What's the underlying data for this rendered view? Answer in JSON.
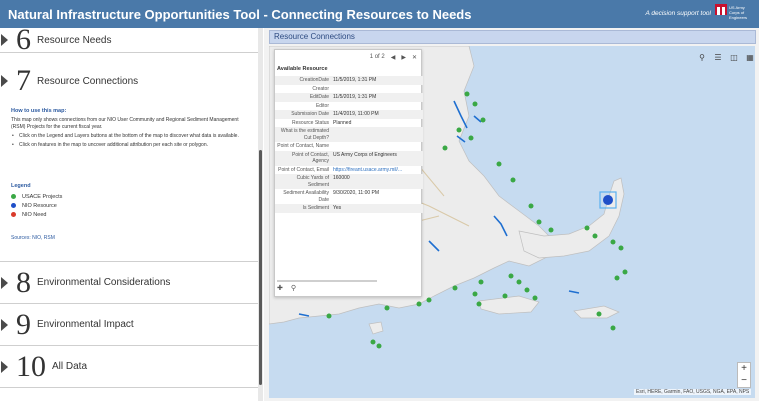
{
  "header": {
    "title": "Natural Infrastructure Opportunities Tool - Connecting Resources to Needs",
    "tagline": "A decision support tool",
    "org_logo_text": "US Army Corps of Engineers"
  },
  "sections": [
    {
      "number": "6",
      "label": "Resource Needs"
    },
    {
      "number": "7",
      "label": "Resource Connections"
    },
    {
      "number": "8",
      "label": "Environmental Considerations"
    },
    {
      "number": "9",
      "label": "Environmental Impact"
    },
    {
      "number": "10",
      "label": "All Data"
    }
  ],
  "howto": {
    "heading": "How to use this map:",
    "intro": "This map only shows connections from our NIO User Community and Regional Sediment Management (RSM) Projects for the current fiscal year.",
    "bullets": [
      "Click on the Legend and Layers buttons at the bottom of the map to discover what data is available.",
      "Click on features in the map to uncover additional attribution per each site or polygon."
    ]
  },
  "legend": {
    "heading": "Legend",
    "items": [
      {
        "label": "USACE Projects",
        "color": "#3aa845"
      },
      {
        "label": "NIO Resource",
        "color": "#1f4fc8"
      },
      {
        "label": "NIO Need",
        "color": "#d93a2b"
      }
    ]
  },
  "sources": "Sources: NIO, RSM",
  "map": {
    "panel_title": "Resource Connections",
    "tool_icons": [
      "search-icon",
      "list-icon",
      "layers-icon",
      "grid-icon"
    ],
    "zoom_in": "+",
    "zoom_out": "−",
    "attribution": "Esri, HERE, Garmin, FAO, USGS, NGA, EPA, NPS"
  },
  "popup": {
    "pager": "1 of 2",
    "title": "Available Resource",
    "fields": [
      {
        "key": "CreationDate",
        "value": "11/5/2019, 1:31 PM"
      },
      {
        "key": "Creator",
        "value": ""
      },
      {
        "key": "EditDate",
        "value": "11/5/2019, 1:31 PM"
      },
      {
        "key": "Editor",
        "value": ""
      },
      {
        "key": "Submission Date",
        "value": "11/4/2019, 11:00 PM"
      },
      {
        "key": "Resource Status",
        "value": "Planned"
      },
      {
        "key": "What is the estimated Cut Depth?",
        "value": ""
      },
      {
        "key": "Point of Contact, Name",
        "value": ""
      },
      {
        "key": "Point of Contact, Agency",
        "value": "US Army Corps of Engineers"
      },
      {
        "key": "Point of Contact, Email",
        "value": "https://fireant.usace.army.mil/..."
      },
      {
        "key": "Cubic Yards of Sediment",
        "value": "160000"
      },
      {
        "key": "Sediment Availability Date",
        "value": "9/30/2020, 11:00 PM"
      },
      {
        "key": "Is Sediment",
        "value": "Yes"
      }
    ],
    "footer_icons": [
      "zoom-to-icon",
      "search-icon"
    ]
  }
}
